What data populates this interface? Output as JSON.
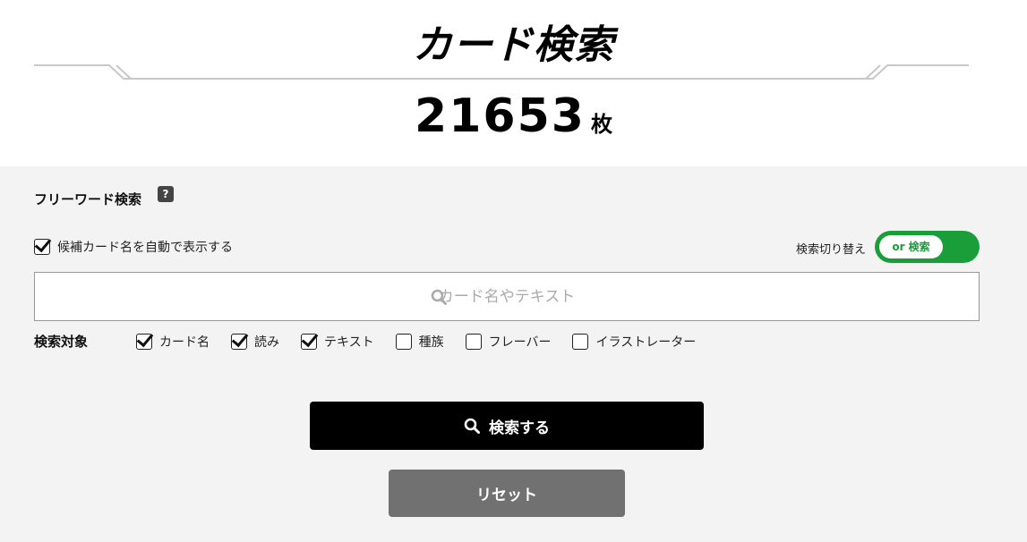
{
  "header": {
    "title": "カード検索",
    "count": "21653",
    "count_unit": "枚"
  },
  "freeword": {
    "label": "フリーワード検索",
    "help_icon_text": "?",
    "autocomplete_label": "候補カード名を自動で表示する",
    "autocomplete_checked": true,
    "mode_switch_label": "検索切り替え",
    "mode_value": "or 検索",
    "search_placeholder": "カード名やテキスト",
    "search_value": ""
  },
  "targets": {
    "label": "検索対象",
    "options": [
      {
        "label": "カード名",
        "checked": true
      },
      {
        "label": "読み",
        "checked": true
      },
      {
        "label": "テキスト",
        "checked": true
      },
      {
        "label": "種族",
        "checked": false
      },
      {
        "label": "フレーバー",
        "checked": false
      },
      {
        "label": "イラストレーター",
        "checked": false
      }
    ]
  },
  "buttons": {
    "search_label": "検索する",
    "reset_label": "リセット"
  },
  "icons": {
    "search": "search-icon",
    "help": "help-icon"
  },
  "colors": {
    "toggle_green": "#1a9e3a",
    "search_button": "#000000",
    "reset_button": "#717171",
    "panel_bg": "#f3f3f3"
  }
}
